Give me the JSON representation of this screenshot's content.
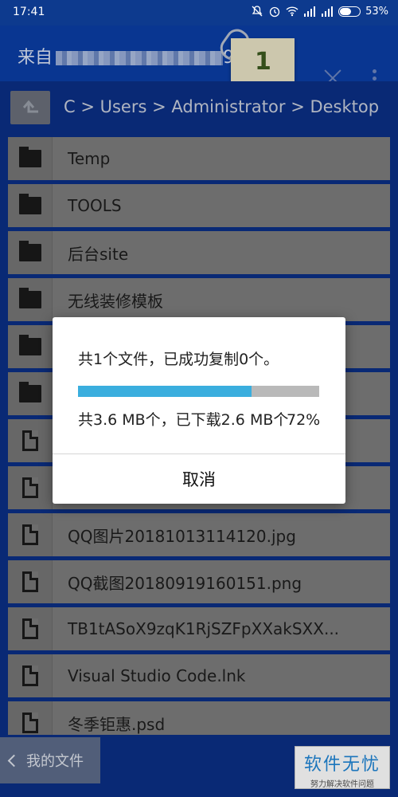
{
  "status": {
    "time": "17:41",
    "battery": "53%"
  },
  "header": {
    "title_prefix": "来自",
    "title_suffix": "9",
    "badge_count": "1"
  },
  "path": {
    "text": "C > Users > Administrator > Desktop"
  },
  "files": [
    {
      "type": "folder",
      "name": "Temp"
    },
    {
      "type": "folder",
      "name": "TOOLS"
    },
    {
      "type": "folder",
      "name": "后台site"
    },
    {
      "type": "folder",
      "name": "无线装修模板"
    },
    {
      "type": "folder",
      "name": ""
    },
    {
      "type": "folder",
      "name": ""
    },
    {
      "type": "file",
      "name": ""
    },
    {
      "type": "file",
      "name": ""
    },
    {
      "type": "file",
      "name": "QQ图片20181013114120.jpg"
    },
    {
      "type": "file",
      "name": "QQ截图20180919160151.png"
    },
    {
      "type": "file",
      "name": "TB1tASoX9zqK1RjSZFpXXakSXX..."
    },
    {
      "type": "file",
      "name": "Visual Studio Code.lnk"
    },
    {
      "type": "file",
      "name": "冬季钜惠.psd"
    }
  ],
  "dialog": {
    "message": "共1个文件，已成功复制0个。",
    "progress_fraction": 0.72,
    "sub": "共3.6 MB个，已下载2.6 MB个",
    "percent": "72%",
    "cancel": "取消"
  },
  "bottom": {
    "my_files": "我的文件"
  },
  "watermark": {
    "title": "软件无忧",
    "subtitle": "努力解决软件问题"
  }
}
